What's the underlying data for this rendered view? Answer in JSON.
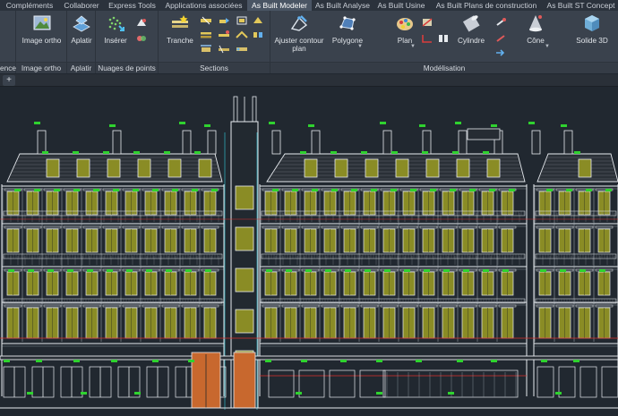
{
  "tabs": [
    {
      "label": "Compléments"
    },
    {
      "label": "Collaborer"
    },
    {
      "label": "Express Tools"
    },
    {
      "label": "Applications associées"
    },
    {
      "label": "As Built Modeler"
    },
    {
      "label": "As Built Analyse"
    },
    {
      "label": "As Built Usine"
    },
    {
      "label": "As Built Plans de construction"
    },
    {
      "label": "As Built ST Concept"
    }
  ],
  "ribbon": {
    "panels": {
      "p0": "ences",
      "p1": "Image ortho",
      "p2": "Aplatir",
      "p3": "Nuages de points",
      "p4": "Sections",
      "p5": "Modélisation"
    },
    "tools": {
      "image_ortho": "Image ortho",
      "aplatir": "Aplatir",
      "inserer": "Insérer",
      "tranche": "Tranche",
      "ajuster_line1": "Ajuster contour",
      "ajuster_line2": "plan",
      "polygone": "Polygone",
      "plan": "Plan",
      "cylindre": "Cylindre",
      "cone": "Cône",
      "solide3d": "Solide 3D"
    }
  },
  "filestrip": {
    "plus_label": "+"
  },
  "colors": {
    "background": "#212830",
    "ribbon": "#3a424d",
    "line_white": "#e8ecf0",
    "window_fill": "#8a8c25",
    "marker_green": "#2fd22f",
    "door_orange": "#c8682e",
    "red_line": "#d8302c",
    "cyan_line": "#2fb6c8"
  },
  "icons": [
    "image-ortho-icon",
    "aplatir-icon",
    "inserer-icon",
    "tranche-icon",
    "ajuster-contour-icon",
    "polygone-icon",
    "plan-icon",
    "cylindre-icon",
    "cone-icon",
    "solide-3d-icon"
  ]
}
